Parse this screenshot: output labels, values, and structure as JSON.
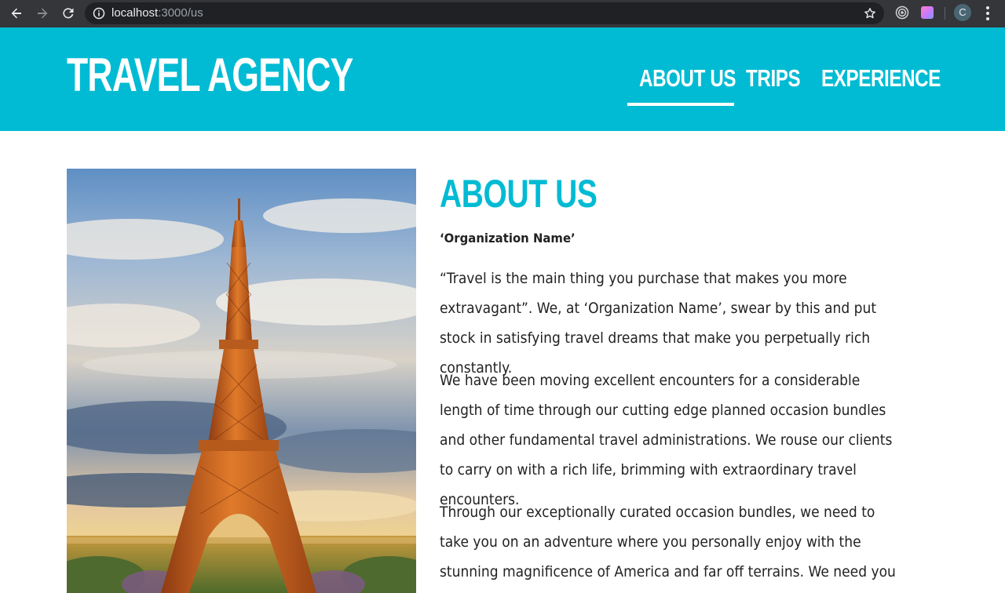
{
  "browser": {
    "url_host": "localhost",
    "url_path": ":3000/us",
    "avatar_initial": "C",
    "icons": [
      "back-arrow-icon",
      "forward-arrow-icon",
      "reload-icon",
      "info-icon",
      "bookmark-star-icon",
      "extension-icon",
      "kebab-menu-icon"
    ]
  },
  "header": {
    "brand": "Travel Agency",
    "nav": [
      {
        "label": "About Us",
        "active": true
      },
      {
        "label": "Trips",
        "active": false
      },
      {
        "label": "Experience",
        "active": false
      }
    ]
  },
  "main": {
    "title": "About Us",
    "org_name": "‘Organization Name’",
    "paragraphs": [
      "“Travel is the main thing you purchase that makes you more extravagant”. We, at ‘Organization Name’, swear by this and put stock in satisfying travel dreams that make you perpetually rich constantly.",
      "We have been moving excellent encounters for a considerable length of time through our cutting edge planned occasion bundles and other fundamental travel administrations. We rouse our clients to carry on with a rich life, brimming with extraordinary travel encounters.",
      "Through our exceptionally curated occasion bundles, we need to take you on an adventure where you personally enjoy with the stunning magnificence of America and far off terrains. We need you to observe"
    ]
  },
  "colors": {
    "accent": "#00bbd3",
    "chrome_bg": "#35363a",
    "omnibox_bg": "#202124",
    "text": "#222222"
  }
}
